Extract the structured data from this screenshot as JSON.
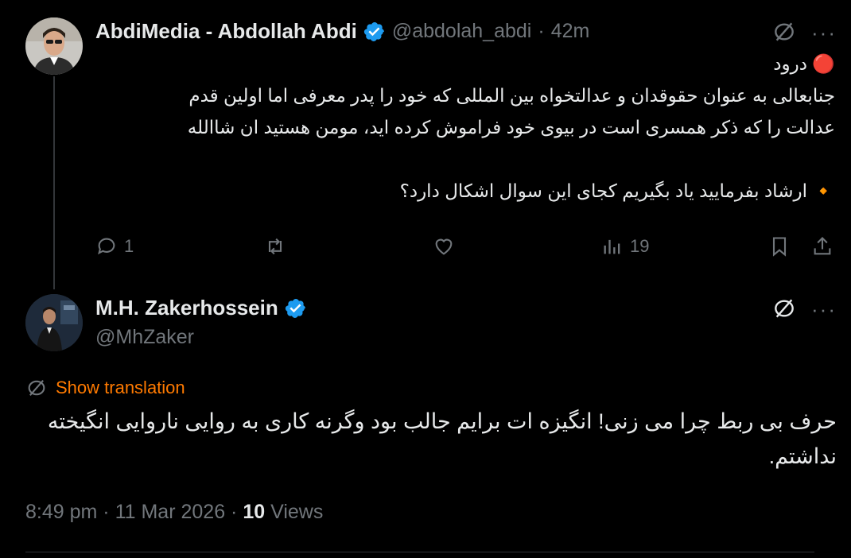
{
  "colors": {
    "background": "#000000",
    "text_primary": "#e7e9ea",
    "text_secondary": "#71767b",
    "verified_blue": "#1d9bf0",
    "accent_orange": "#ff7a00"
  },
  "tweet1": {
    "display_name": "AbdiMedia - Abdollah Abdi",
    "handle": "@abdolah_abdi",
    "separator": "·",
    "time": "42m",
    "line_greeting": "🔴 درود",
    "line_a": "جنابعالی به عنوان حقوقدان و عدالتخواه بین المللی که خود را پدر معرفی اما اولین قدم",
    "line_b": "عدالت را که ذکر همسری است در بیوی خود فراموش کرده اید، مومن هستید ان شاالله",
    "line_question": "🔸 ارشاد بفرمایید یاد بگیریم کجای این سوال اشکال دارد؟",
    "reply_count": "1",
    "views_count": "19",
    "more": "···",
    "icons": [
      "grok-icon",
      "reply-icon",
      "retweet-icon",
      "like-icon",
      "views-icon",
      "bookmark-icon",
      "share-icon"
    ]
  },
  "tweet2": {
    "display_name": "M.H. Zakerhossein",
    "handle": "@MhZaker",
    "show_translation": "Show translation",
    "text_line1": "حرف بی ربط چرا می زنی! انگیزه ات برایم جالب بود وگرنه کاری به روایی ناروایی انگیخته",
    "text_line2": "نداشتم.",
    "time": "8:49 pm",
    "date": "11 Mar 2026",
    "separator": "·",
    "views_count": "10",
    "views_label": "Views",
    "more": "···"
  }
}
